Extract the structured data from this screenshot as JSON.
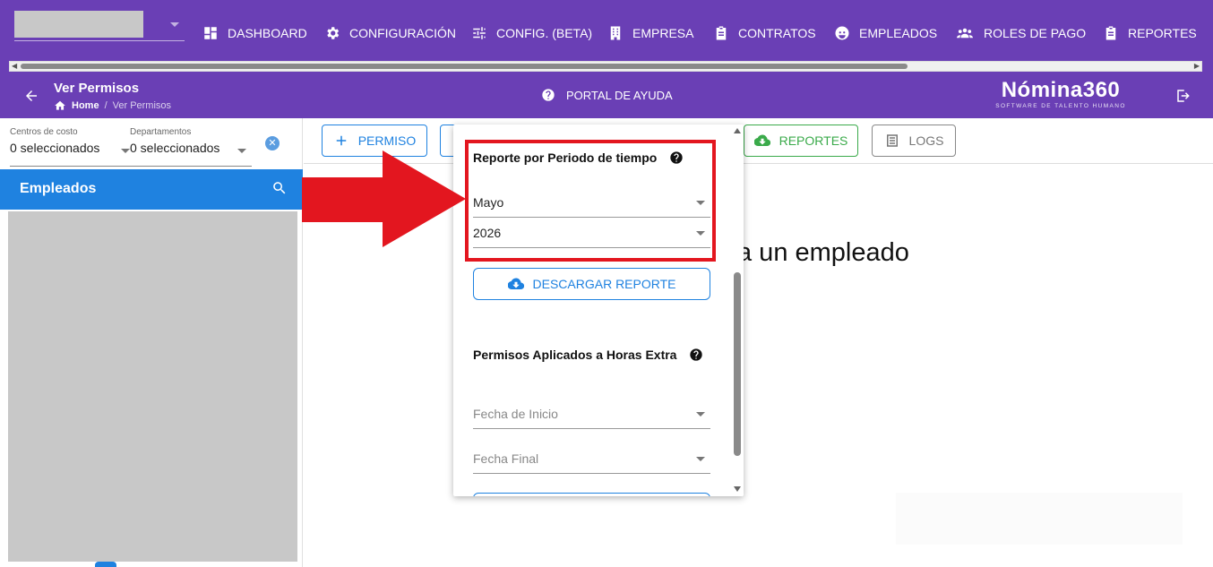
{
  "topnav": {
    "items": [
      {
        "label": "DASHBOARD",
        "icon": "dashboard-icon"
      },
      {
        "label": "CONFIGURACIÓN",
        "icon": "gear-icon"
      },
      {
        "label": "CONFIG. (BETA)",
        "icon": "sliders-icon"
      },
      {
        "label": "EMPRESA",
        "icon": "building-icon"
      },
      {
        "label": "CONTRATOS",
        "icon": "clipboard-icon"
      },
      {
        "label": "EMPLEADOS",
        "icon": "face-icon"
      },
      {
        "label": "ROLES DE PAGO",
        "icon": "people-icon"
      },
      {
        "label": "REPORTES",
        "icon": "clipboard-icon"
      }
    ]
  },
  "header": {
    "title": "Ver Permisos",
    "breadcrumb_home": "Home",
    "breadcrumb_sep": "/",
    "breadcrumb_current": "Ver Permisos",
    "help_label": "PORTAL DE AYUDA",
    "logo_main": "Nómina360",
    "logo_sub": "SOFTWARE DE TALENTO HUMANO"
  },
  "sidebar": {
    "cost_centers_label": "Centros de costo",
    "cost_centers_value": "0 seleccionados",
    "departments_label": "Departamentos",
    "departments_value": "0 seleccionados",
    "employees_title": "Empleados"
  },
  "toolbar": {
    "permiso_label": "PERMISO",
    "reportes_label": "REPORTES",
    "logs_label": "LOGS"
  },
  "main": {
    "placeholder_text": "a un empleado"
  },
  "report_menu": {
    "period_title": "Reporte por Periodo de tiempo",
    "month_value": "Mayo",
    "year_value": "2026",
    "download_label": "DESCARGAR REPORTE",
    "overtime_title": "Permisos Aplicados a Horas Extra",
    "start_date_placeholder": "Fecha de Inicio",
    "end_date_placeholder": "Fecha Final"
  },
  "colors": {
    "brand_purple": "#6a3fb5",
    "primary_blue": "#1f82e0",
    "success_green": "#3aaa4a",
    "annotation_red": "#e3161f"
  }
}
